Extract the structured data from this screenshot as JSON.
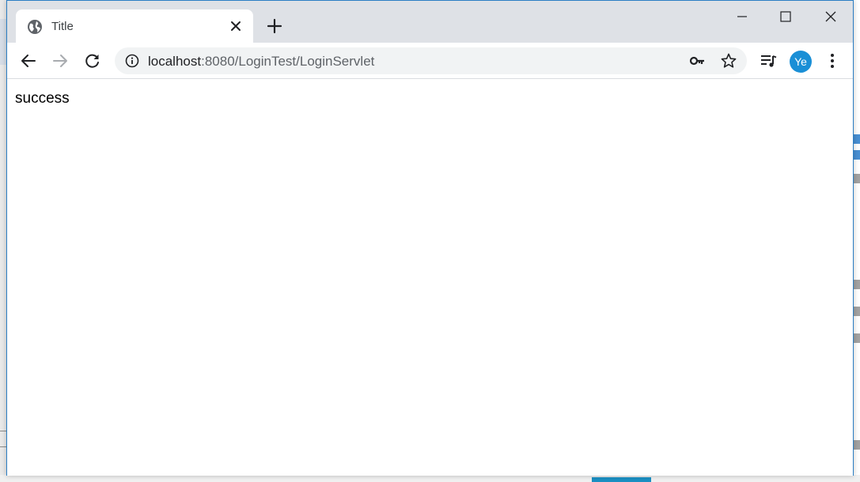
{
  "browser": {
    "tab": {
      "title": "Title"
    },
    "address_bar": {
      "host": "localhost",
      "rest": ":8080/LoginTest/LoginServlet"
    },
    "profile": {
      "initials": "Ye",
      "color": "#1a8fd6"
    }
  },
  "page": {
    "body_text": "success"
  },
  "colors": {
    "tabstrip": "#dee1e6",
    "window_border": "#2b7ec4"
  },
  "icons": [
    "globe-icon",
    "close-icon",
    "plus-icon",
    "minimize-icon",
    "maximize-icon",
    "back-arrow-icon",
    "forward-arrow-icon",
    "reload-icon",
    "info-icon",
    "key-icon",
    "star-icon",
    "media-queue-icon",
    "more-vert-icon"
  ]
}
